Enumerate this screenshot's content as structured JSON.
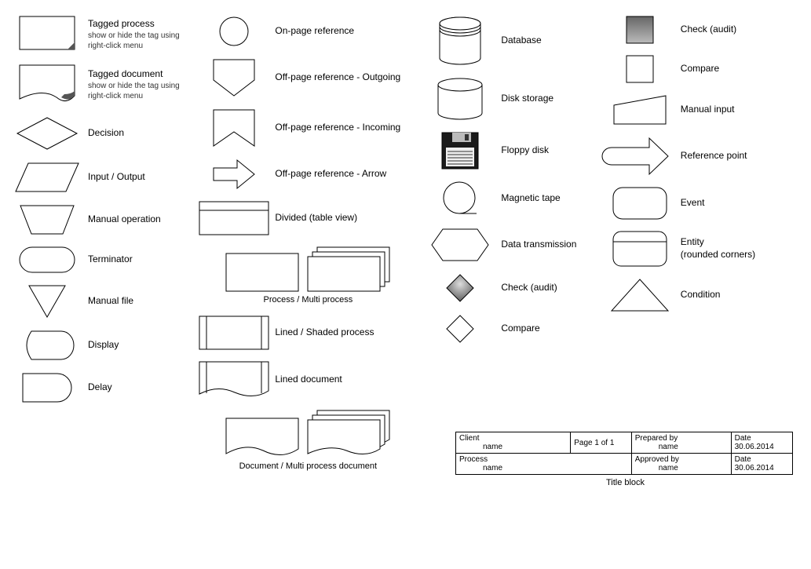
{
  "col1": {
    "tagged_process": {
      "title": "Tagged process",
      "sub": "show or hide the tag using right-click menu"
    },
    "tagged_document": {
      "title": "Tagged document",
      "sub": "show or hide the tag using right-click menu"
    },
    "decision": "Decision",
    "input_output": "Input / Output",
    "manual_operation": "Manual operation",
    "terminator": "Terminator",
    "manual_file": "Manual file",
    "display": "Display",
    "delay": "Delay"
  },
  "col2": {
    "on_page_ref": "On-page reference",
    "off_outgoing": "Off-page reference - Outgoing",
    "off_incoming": "Off-page reference - Incoming",
    "off_arrow": "Off-page reference - Arrow",
    "divided": "Divided (table view)",
    "process_multi": "Process / Multi process",
    "lined_shaded": "Lined / Shaded process",
    "lined_doc": "Lined document",
    "doc_multi": "Document / Multi process document"
  },
  "col3": {
    "database": "Database",
    "disk_storage": "Disk storage",
    "floppy": "Floppy disk",
    "magnetic_tape": "Magnetic tape",
    "data_transmission": "Data transmission",
    "check_audit": "Check (audit)",
    "compare": "Compare"
  },
  "col4": {
    "check_audit": "Check (audit)",
    "compare": "Compare",
    "manual_input": "Manual input",
    "reference_point": "Reference point",
    "event": "Event",
    "entity": "Entity\n(rounded corners)",
    "condition": "Condition"
  },
  "titleblock": {
    "client_label": "Client",
    "client_value": "name",
    "page": "Page 1  of  1",
    "prepared_label": "Prepared by",
    "prepared_value": "name",
    "date_label1": "Date",
    "date_value1": "30.06.2014",
    "process_label": "Process",
    "process_value": "name",
    "approved_label": "Approved by",
    "approved_value": "name",
    "date_label2": "Date",
    "date_value2": "30.06.2014",
    "caption": "Title block"
  }
}
